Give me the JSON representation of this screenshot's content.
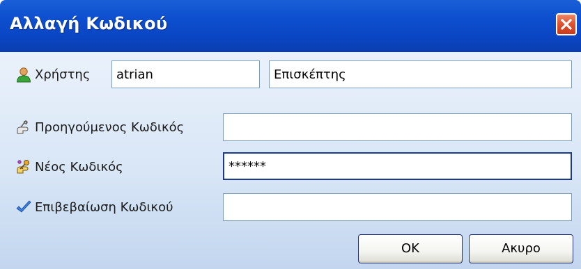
{
  "window": {
    "title": "Αλλαγή Κωδικού"
  },
  "user": {
    "label": "Χρήστης",
    "username": "atrian",
    "display_name": "Επισκέπτης"
  },
  "previous_password": {
    "label": "Προηγούμενος Κωδικός",
    "value": ""
  },
  "new_password": {
    "label": "Νέος Κωδικός",
    "value": "******"
  },
  "confirm_password": {
    "label": "Επιβεβαίωση Κωδικού",
    "value": ""
  },
  "buttons": {
    "ok": "OK",
    "cancel": "Ακυρο"
  },
  "icons": {
    "user": "user-icon",
    "previous_password": "hand-key-icon",
    "new_password": "keys-icon",
    "confirm": "checkmark-icon",
    "close": "close-icon"
  },
  "colors": {
    "titlebar": "#0a46c4",
    "close_button": "#dd5533",
    "client_background": "#d8e6f6",
    "active_field_border": "#1b3a8c"
  }
}
